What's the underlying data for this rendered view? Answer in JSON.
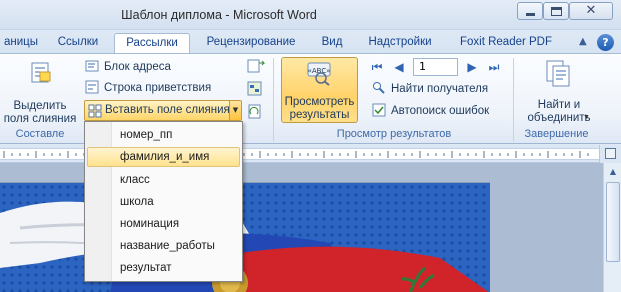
{
  "window": {
    "title": "Шаблон диплома  -  Microsoft Word",
    "minimize_glyph": "",
    "close_glyph": "✕"
  },
  "tabs": [
    {
      "label": "аницы"
    },
    {
      "label": "Ссылки"
    },
    {
      "label": "Рассылки",
      "active": true
    },
    {
      "label": "Рецензирование"
    },
    {
      "label": "Вид"
    },
    {
      "label": "Надстройки"
    },
    {
      "label": "Foxit Reader PDF"
    }
  ],
  "help_label": "?",
  "ribbon": {
    "compose_group": {
      "label": "Составле",
      "select_fields": "Выделить\nполя слияния",
      "address_block": "Блок адреса",
      "greeting_line": "Строка приветствия",
      "insert_merge_field": "Вставить поле слияния"
    },
    "preview_group": {
      "label": "Просмотр результатов",
      "preview_button": "Просмотреть\nрезультаты",
      "record_value": "1",
      "find_recipient": "Найти получателя",
      "auto_check": "Автопоиск ошибок"
    },
    "finish_group": {
      "label": "Завершение",
      "finish_merge": "Найти и\nобъединить"
    }
  },
  "merge_fields_menu": {
    "items": [
      "номер_пп",
      "фамилия_и_имя",
      "класс",
      "школа",
      "номинация",
      "название_работы",
      "результат"
    ],
    "highlighted_index": 1
  },
  "colors": {
    "ribbon_accent": "#15428b",
    "highlight": "#ffe28e",
    "flag_blue": "#1f4fa8",
    "flag_red": "#d1232a"
  }
}
